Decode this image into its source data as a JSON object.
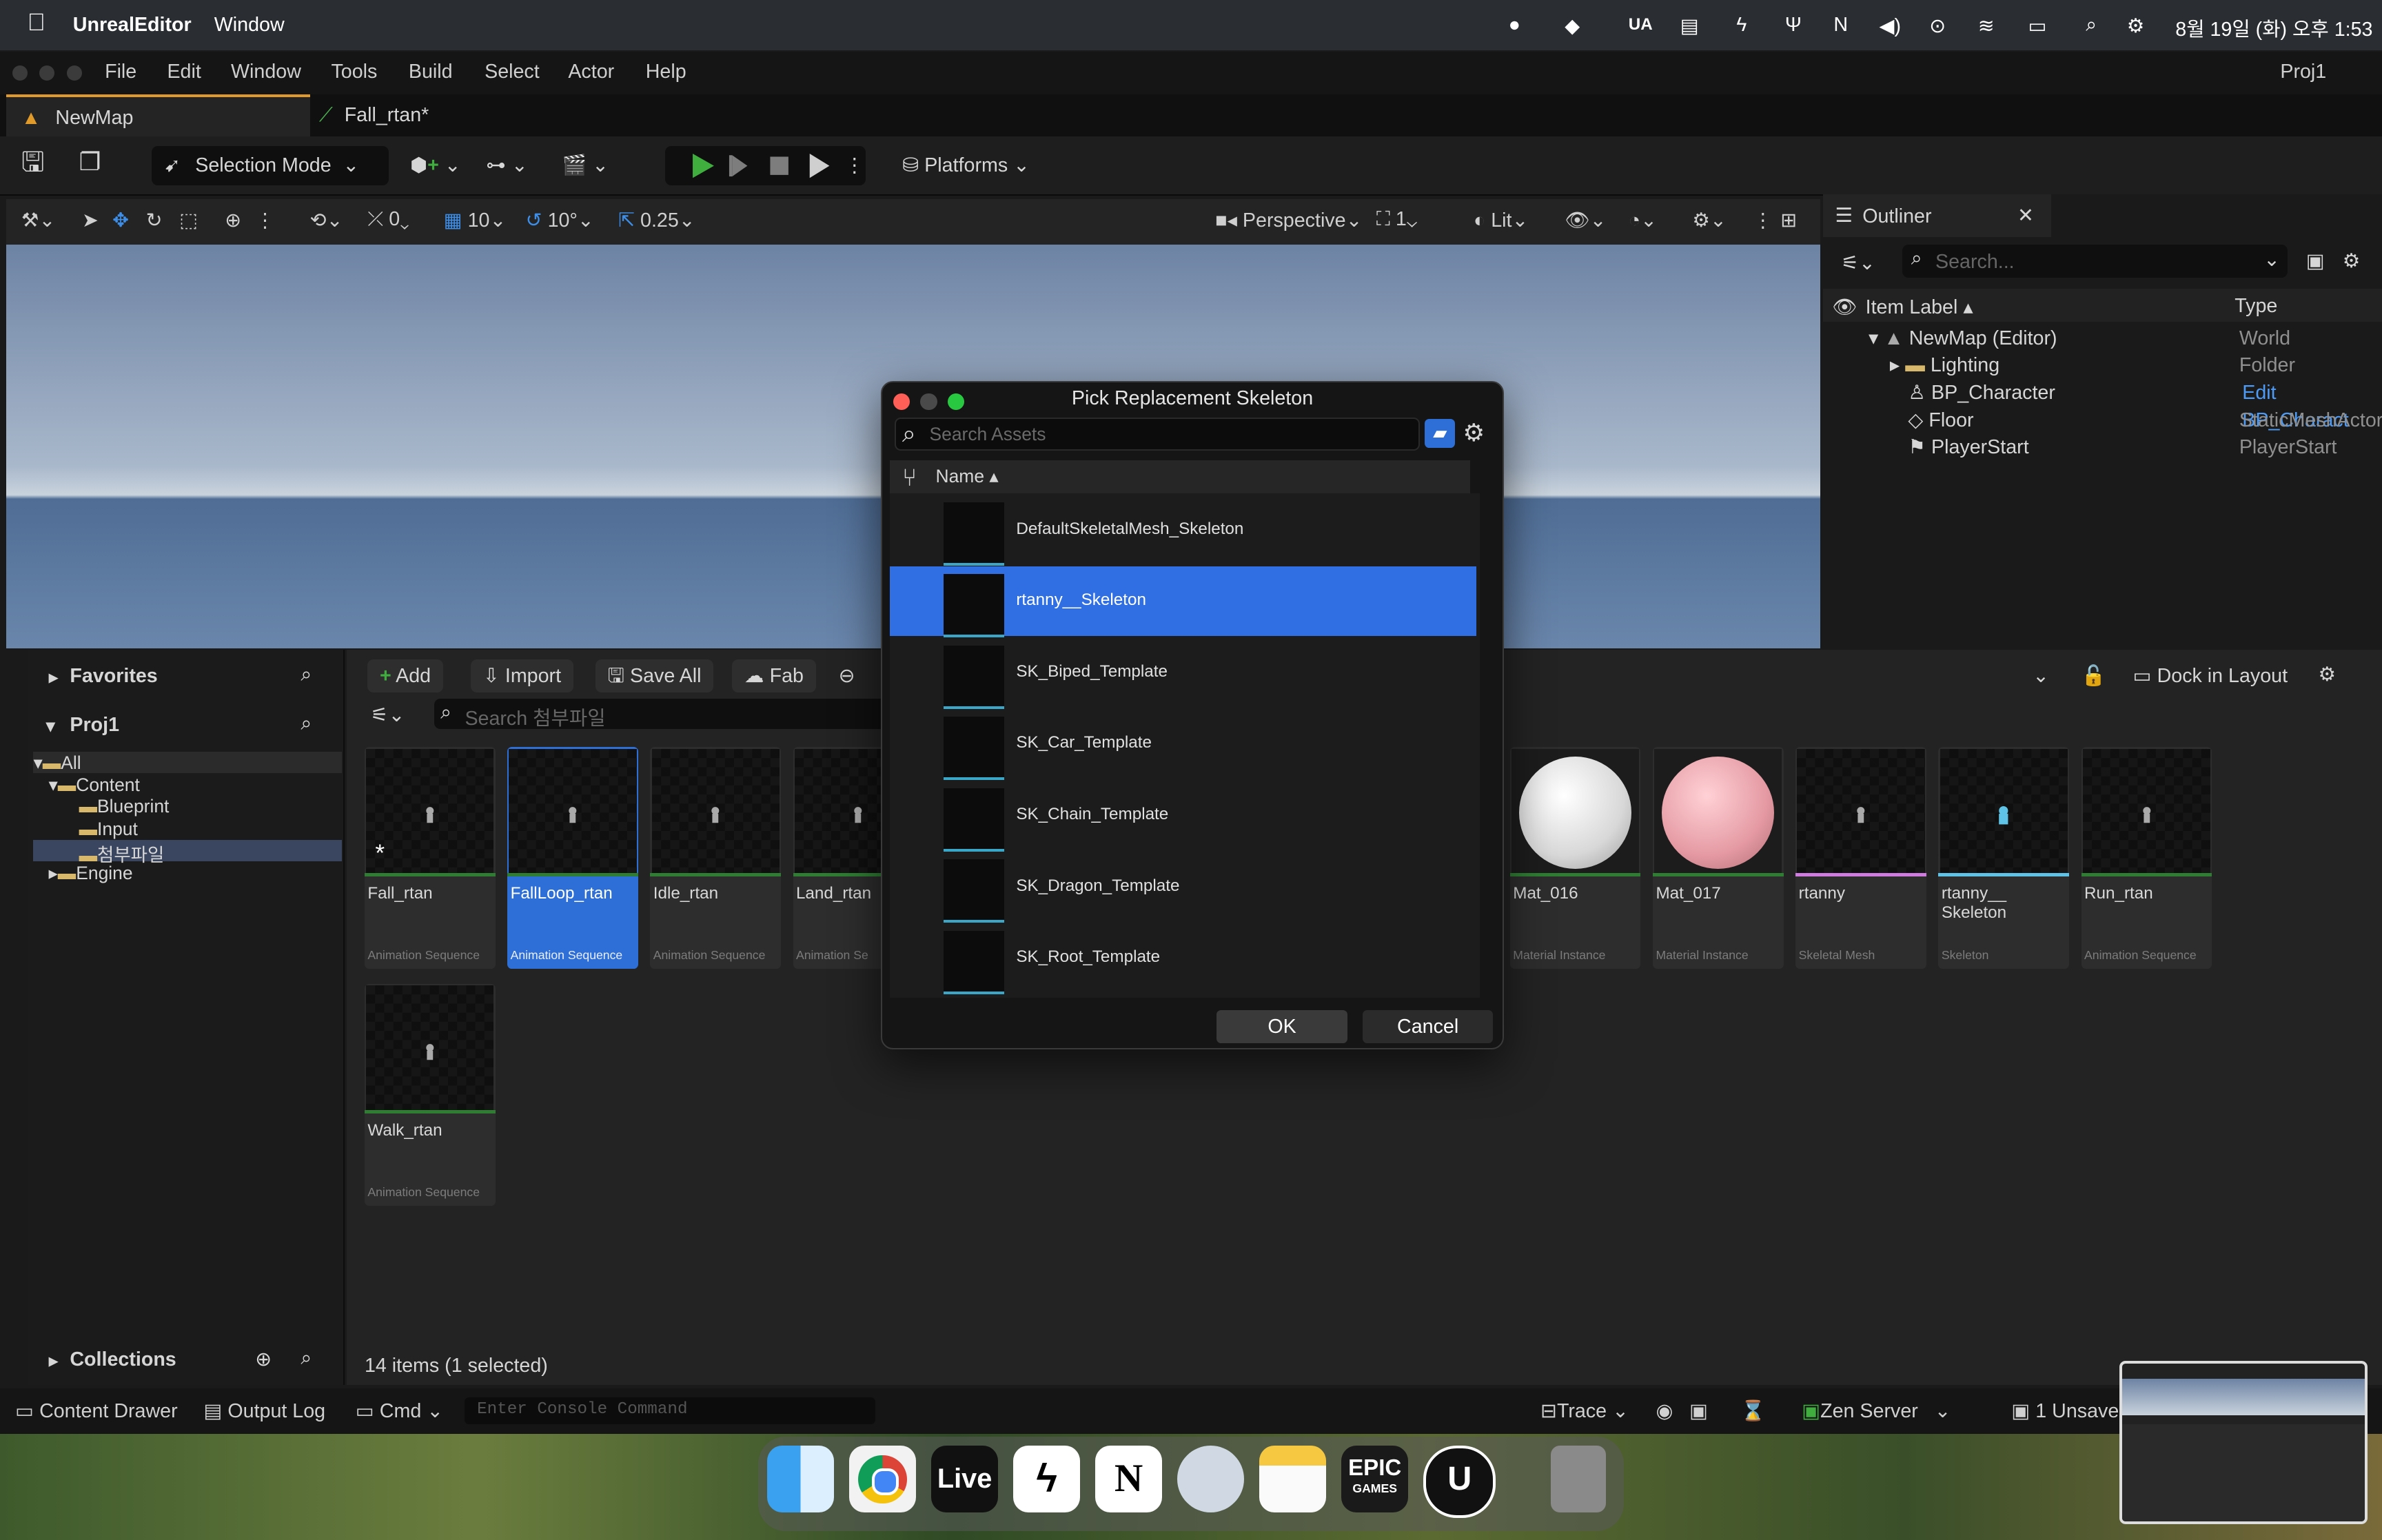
{
  "macbar": {
    "app": "UnrealEditor",
    "menu": "Window",
    "input": "UA",
    "datetime": "8월 19일 (화) 오후 1:53"
  },
  "menubar": {
    "items": [
      "File",
      "Edit",
      "Window",
      "Tools",
      "Build",
      "Select",
      "Actor",
      "Help"
    ],
    "project": "Proj1"
  },
  "tabs": [
    {
      "label": "NewMap"
    },
    {
      "label": "Fall_rtan*"
    }
  ],
  "toolbar": {
    "selection_mode": "Selection Mode",
    "platforms": "Platforms"
  },
  "viewport": {
    "snap_rotate": "0",
    "grid": "10",
    "angle": "10°",
    "scale": "0.25",
    "perspective": "Perspective",
    "cameras": "1",
    "lit": "Lit"
  },
  "outliner": {
    "title": "Outliner",
    "search_placeholder": "Search...",
    "col_label": "Item Label",
    "col_type": "Type",
    "rows": [
      {
        "label": "NewMap (Editor)",
        "type": "World"
      },
      {
        "label": "Lighting",
        "type": "Folder"
      },
      {
        "label": "BP_Character",
        "type": "Edit BP_Charact"
      },
      {
        "label": "Floor",
        "type": "StaticMeshActor"
      },
      {
        "label": "PlayerStart",
        "type": "PlayerStart"
      }
    ]
  },
  "content_browser": {
    "favorites": "Favorites",
    "project": "Proj1",
    "tree": [
      "All",
      "Content",
      "Blueprint",
      "Input",
      "첨부파일",
      "Engine"
    ],
    "collections": "Collections",
    "add": "Add",
    "import": "Import",
    "save_all": "Save All",
    "fab": "Fab",
    "search_placeholder": "Search 첨부파일",
    "dock_in_layout": "Dock in Layout",
    "items_count": "14 items (1 selected)",
    "assets": [
      {
        "name": "Fall_rtan",
        "type": "Animation Sequence"
      },
      {
        "name": "FallLoop_rtan",
        "type": "Animation Sequence"
      },
      {
        "name": "Idle_rtan",
        "type": "Animation Sequence"
      },
      {
        "name": "Land_rtan",
        "type": "Animation Se"
      },
      {
        "name": "Mat_016",
        "type": "Material Instance"
      },
      {
        "name": "Mat_017",
        "type": "Material Instance"
      },
      {
        "name": "rtanny",
        "type": "Skeletal Mesh"
      },
      {
        "name": "rtanny__ Skeleton",
        "type": "Skeleton"
      },
      {
        "name": "Run_rtan",
        "type": "Animation Sequence"
      },
      {
        "name": "Walk_rtan",
        "type": "Animation Sequence"
      }
    ]
  },
  "dialog": {
    "title": "Pick Replacement Skeleton",
    "search_placeholder": "Search Assets",
    "col_name": "Name",
    "rows": [
      {
        "label": "DefaultSkeletalMesh_Skeleton"
      },
      {
        "label": "rtanny__Skeleton"
      },
      {
        "label": "SK_Biped_Template"
      },
      {
        "label": "SK_Car_Template"
      },
      {
        "label": "SK_Chain_Template"
      },
      {
        "label": "SK_Dragon_Template"
      },
      {
        "label": "SK_Root_Template"
      }
    ],
    "ok": "OK",
    "cancel": "Cancel"
  },
  "statusbar": {
    "content_drawer": "Content Drawer",
    "output_log": "Output Log",
    "cmd": "Cmd",
    "console_placeholder": "Enter Console Command",
    "trace": "Trace",
    "zen_server": "Zen Server",
    "unsaved": "1 Unsave"
  },
  "dock": {
    "live_label": "Live",
    "epic_label": "EPIC",
    "epic_sub": "GAMES"
  },
  "colors": {
    "accent_blue": "#2d6fd6",
    "play_green": "#3fae3f",
    "selection_row": "#2f6ee3"
  }
}
